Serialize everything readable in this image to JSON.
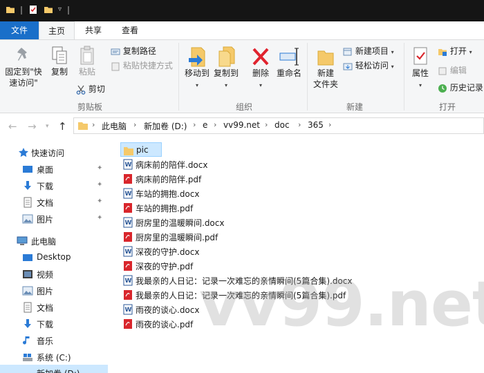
{
  "titlebar": {
    "icons": [
      "folder-icon",
      "properties-icon",
      "new-folder-icon",
      "customize-dropdown-icon"
    ]
  },
  "ribbon_tabs": {
    "file": "文件",
    "home": "主页",
    "share": "共享",
    "view": "查看"
  },
  "ribbon": {
    "clipboard": {
      "pin": "固定到\"快",
      "pin2": "速访问\"",
      "copy": "复制",
      "paste": "粘贴",
      "copy_path": "复制路径",
      "paste_shortcut": "粘贴快捷方式",
      "cut": "剪切",
      "label": "剪贴板"
    },
    "organize": {
      "move_to": "移动到",
      "copy_to": "复制到",
      "delete": "删除",
      "rename": "重命名",
      "label": "组织"
    },
    "new": {
      "new_folder": "新建",
      "new_folder2": "文件夹",
      "new_item": "新建项目",
      "easy_access": "轻松访问",
      "label": "新建"
    },
    "open": {
      "properties": "属性",
      "open": "打开",
      "edit": "编辑",
      "history": "历史记录",
      "label": "打开"
    }
  },
  "address": {
    "crumbs": [
      "此电脑",
      "新加卷 (D:)",
      "e",
      "vv99.net",
      "doc",
      "365"
    ]
  },
  "nav_pane": {
    "quick_access": "快速访问",
    "desktop": "桌面",
    "downloads": "下载",
    "documents": "文档",
    "pictures": "图片",
    "this_pc": "此电脑",
    "pc_desktop": "Desktop",
    "pc_videos": "视频",
    "pc_pictures": "图片",
    "pc_documents": "文档",
    "pc_downloads": "下载",
    "pc_music": "音乐",
    "drive_c": "系统 (C:)",
    "drive_d": "新加卷 (D:)"
  },
  "files": [
    {
      "name": "pic",
      "type": "folder"
    },
    {
      "name": "病床前的陪伴.docx",
      "type": "docx"
    },
    {
      "name": "病床前的陪伴.pdf",
      "type": "pdf"
    },
    {
      "name": "车站的拥抱.docx",
      "type": "docx"
    },
    {
      "name": "车站的拥抱.pdf",
      "type": "pdf"
    },
    {
      "name": "厨房里的温暖瞬间.docx",
      "type": "docx"
    },
    {
      "name": "厨房里的温暖瞬间.pdf",
      "type": "pdf"
    },
    {
      "name": "深夜的守护.docx",
      "type": "docx"
    },
    {
      "name": "深夜的守护.pdf",
      "type": "pdf"
    },
    {
      "name": "我最亲的人日记：记录一次难忘的亲情瞬间(5篇合集).docx",
      "type": "docx"
    },
    {
      "name": "我最亲的人日记：记录一次难忘的亲情瞬间(5篇合集).pdf",
      "type": "pdf"
    },
    {
      "name": "雨夜的谈心.docx",
      "type": "docx"
    },
    {
      "name": "雨夜的谈心.pdf",
      "type": "pdf"
    }
  ],
  "watermark": "vv99.net",
  "colors": {
    "accent": "#1a6fc9",
    "selection": "#cce8ff",
    "folder": "#f5c96a",
    "pdf_red": "#d9262c",
    "word_blue": "#2b5797",
    "delete_red": "#e0232e"
  }
}
